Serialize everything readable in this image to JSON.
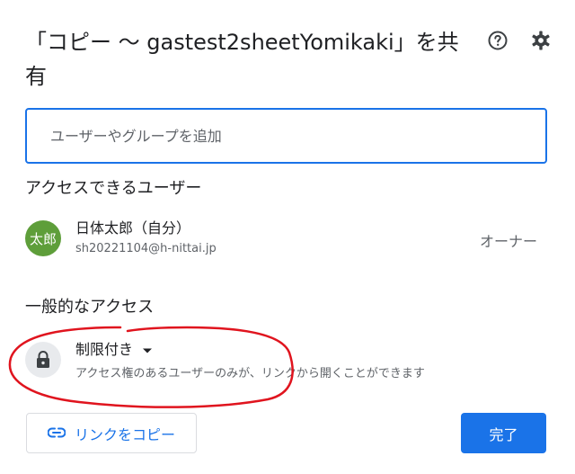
{
  "dialog": {
    "title": "「コピー ～ gastest2sheetYomikaki」を共有",
    "icons": {
      "help": "help-circle-icon",
      "settings": "gear-icon"
    }
  },
  "add_people": {
    "placeholder": "ユーザーやグループを追加"
  },
  "people_section": {
    "heading": "アクセスできるユーザー",
    "users": [
      {
        "avatar_text": "太郎",
        "avatar_color": "#5e9e3a",
        "name": "日体太郎（自分）",
        "email": "sh20221104@h-nittai.jp",
        "role": "オーナー"
      }
    ]
  },
  "general_access": {
    "heading": "一般的なアクセス",
    "lock_icon": "lock-icon",
    "selected": "制限付き",
    "description": "アクセス権のあるユーザーのみが、リンクから開くことができます"
  },
  "footer": {
    "copy_link_label": "リンクをコピー",
    "copy_link_icon": "link-icon",
    "done_label": "完了"
  },
  "colors": {
    "accent": "#1a73e8",
    "annotation": "#e0141e"
  }
}
